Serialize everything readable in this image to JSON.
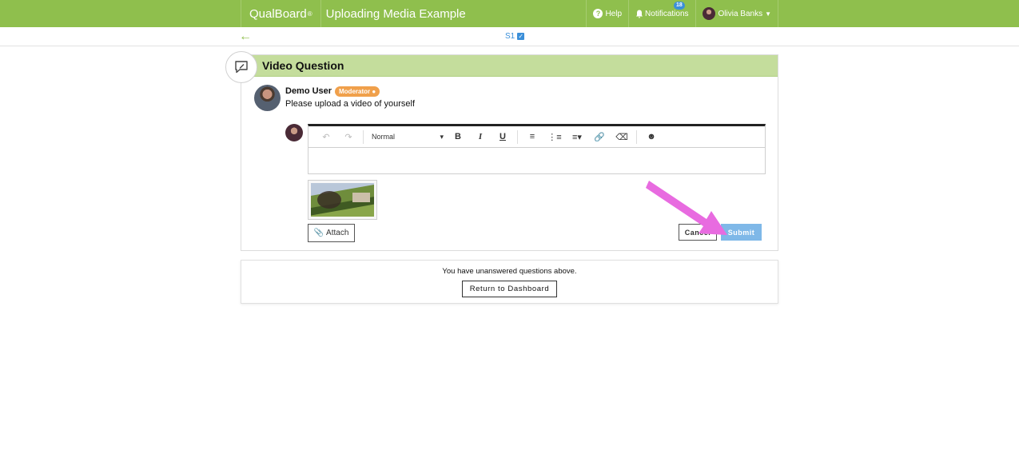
{
  "header": {
    "brand": "QualBoard",
    "brand_mark": "®",
    "study_title": "Uploading Media Example",
    "help_label": "Help",
    "notifications_label": "Notifications",
    "notifications_count": "18",
    "user_name": "Olivia Banks"
  },
  "subnav": {
    "section_label": "S1"
  },
  "question": {
    "title": "Video Question",
    "author": "Demo User",
    "author_role": "Moderator",
    "text": "Please upload a video of yourself"
  },
  "editor": {
    "format_value": "Normal",
    "body_value": ""
  },
  "actions": {
    "attach_label": "Attach",
    "cancel_label": "Cancel",
    "submit_label": "Submit"
  },
  "footer": {
    "message": "You have unanswered questions above.",
    "dashboard_label": "Return to Dashboard"
  },
  "colors": {
    "brand_green": "#8fbf4d",
    "header_light_green": "#c4dd9c",
    "moderator_orange": "#f0a04b",
    "submit_blue": "#7fb8e8",
    "annotation_arrow": "#e86be0"
  }
}
